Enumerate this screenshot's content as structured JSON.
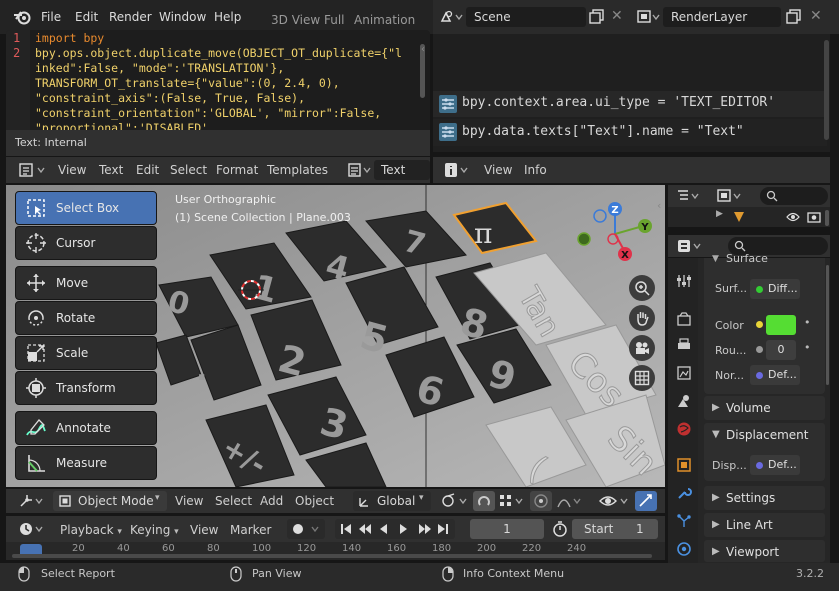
{
  "topbar": {
    "menus": [
      "File",
      "Edit",
      "Render",
      "Window",
      "Help"
    ],
    "workspace_tabs": [
      "3D View Full",
      "Animation"
    ],
    "scene_name": "Scene",
    "render_layer": "RenderLayer"
  },
  "text_editor": {
    "lines": [
      {
        "num": "1",
        "code": "import bpy"
      },
      {
        "num": "2",
        "code": "bpy.ops.object.duplicate_move(OBJECT_OT_duplicate={\"l"
      },
      {
        "num": "",
        "code": "inked\":False, \"mode\":'TRANSLATION'},"
      },
      {
        "num": "",
        "code": "TRANSFORM_OT_translate={\"value\":(0, 2.4, 0),"
      },
      {
        "num": "",
        "code": "\"constraint_axis\":(False, True, False),"
      },
      {
        "num": "",
        "code": "\"constraint_orientation\":'GLOBAL', \"mirror\":False,"
      },
      {
        "num": "",
        "code": "\"proportional\":'DISABLED'"
      }
    ],
    "status": "Text: Internal",
    "header_menus": [
      "View",
      "Text",
      "Edit",
      "Select",
      "Format",
      "Templates"
    ],
    "text_name": "Text"
  },
  "info_editor": {
    "reports": [
      "bpy.context.area.ui_type = 'TEXT_EDITOR'",
      "bpy.data.texts[\"Text\"].name = \"Text\""
    ],
    "header_menus": [
      "View",
      "Info"
    ]
  },
  "viewport": {
    "view_name": "User Orthographic",
    "collection_info": "(1) Scene Collection | Plane.003",
    "tools": [
      "Select Box",
      "Cursor",
      "Move",
      "Rotate",
      "Scale",
      "Transform",
      "Annotate",
      "Measure"
    ],
    "mode": "Object Mode",
    "header_menus": [
      "View",
      "Select",
      "Add",
      "Object"
    ],
    "orientation": "Global",
    "gizmo_axes": {
      "z": "Z",
      "y": "Y",
      "x": "X"
    },
    "key_labels": [
      "0",
      "1",
      "4",
      "7",
      "8",
      "5",
      "2",
      ".",
      "3",
      "6",
      "9",
      "+/-",
      "Tan",
      "Cos",
      "Sin",
      "("
    ]
  },
  "timeline": {
    "menus": [
      "Playback",
      "Keying",
      "View",
      "Marker"
    ],
    "current_frame": "1",
    "start_label": "Start",
    "start_value": "1",
    "ruler": [
      "20",
      "40",
      "60",
      "80",
      "100",
      "120",
      "140",
      "160",
      "180",
      "200",
      "220",
      "240"
    ]
  },
  "properties": {
    "surface_label": "Surface",
    "rows": [
      {
        "label": "Surf...",
        "value": "Diff..."
      },
      {
        "label": "Color",
        "value": ""
      },
      {
        "label": "Rou...",
        "value": "0"
      },
      {
        "label": "Nor...",
        "value": "Def..."
      }
    ],
    "volume": "Volume",
    "displacement": "Displacement",
    "disp_row": {
      "label": "Disp...",
      "value": "Def..."
    },
    "settings": "Settings",
    "line_art": "Line Art",
    "viewport_display": "Viewport Display",
    "color_swatch": "#55dd33"
  },
  "statusbar": {
    "items": [
      "Select Report",
      "Pan View",
      "Info Context Menu"
    ],
    "version": "3.2.2"
  }
}
